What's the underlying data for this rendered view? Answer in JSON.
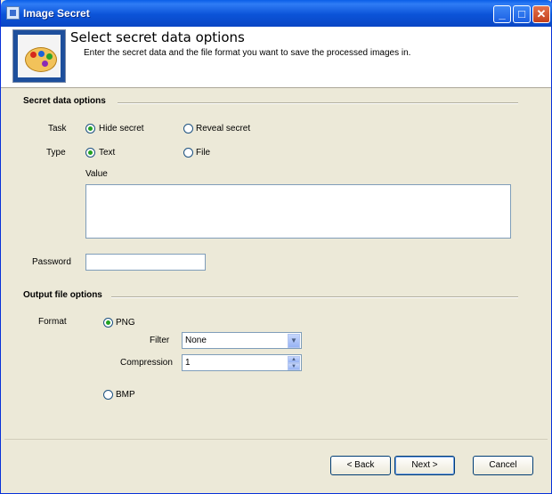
{
  "window": {
    "title": "Image Secret",
    "icon": "app-icon",
    "controls": [
      "minimize",
      "maximize",
      "close"
    ]
  },
  "header": {
    "title": "Select secret data options",
    "subtitle": "Enter the secret data and the file format you want to save the processed images in."
  },
  "secret_data": {
    "section_title": "Secret data options",
    "task": {
      "label": "Task",
      "options": [
        {
          "label": "Hide secret",
          "selected": true
        },
        {
          "label": "Reveal secret",
          "selected": false
        }
      ]
    },
    "type": {
      "label": "Type",
      "options": [
        {
          "label": "Text",
          "selected": true
        },
        {
          "label": "File",
          "selected": false
        }
      ]
    },
    "value_label": "Value",
    "value": "",
    "password_label": "Password",
    "password": ""
  },
  "output": {
    "section_title": "Output file options",
    "format_label": "Format",
    "png_label": "PNG",
    "png_selected": true,
    "filter_label": "Filter",
    "filter_value": "None",
    "compression_label": "Compression",
    "compression_value": "1",
    "bmp_label": "BMP",
    "bmp_selected": false
  },
  "buttons": {
    "back": "< Back",
    "next": "Next >",
    "cancel": "Cancel"
  },
  "colors": {
    "titlebar": "#0b53d8",
    "dialog_bg": "#ece9d8",
    "radio_dot": "#21a121"
  }
}
